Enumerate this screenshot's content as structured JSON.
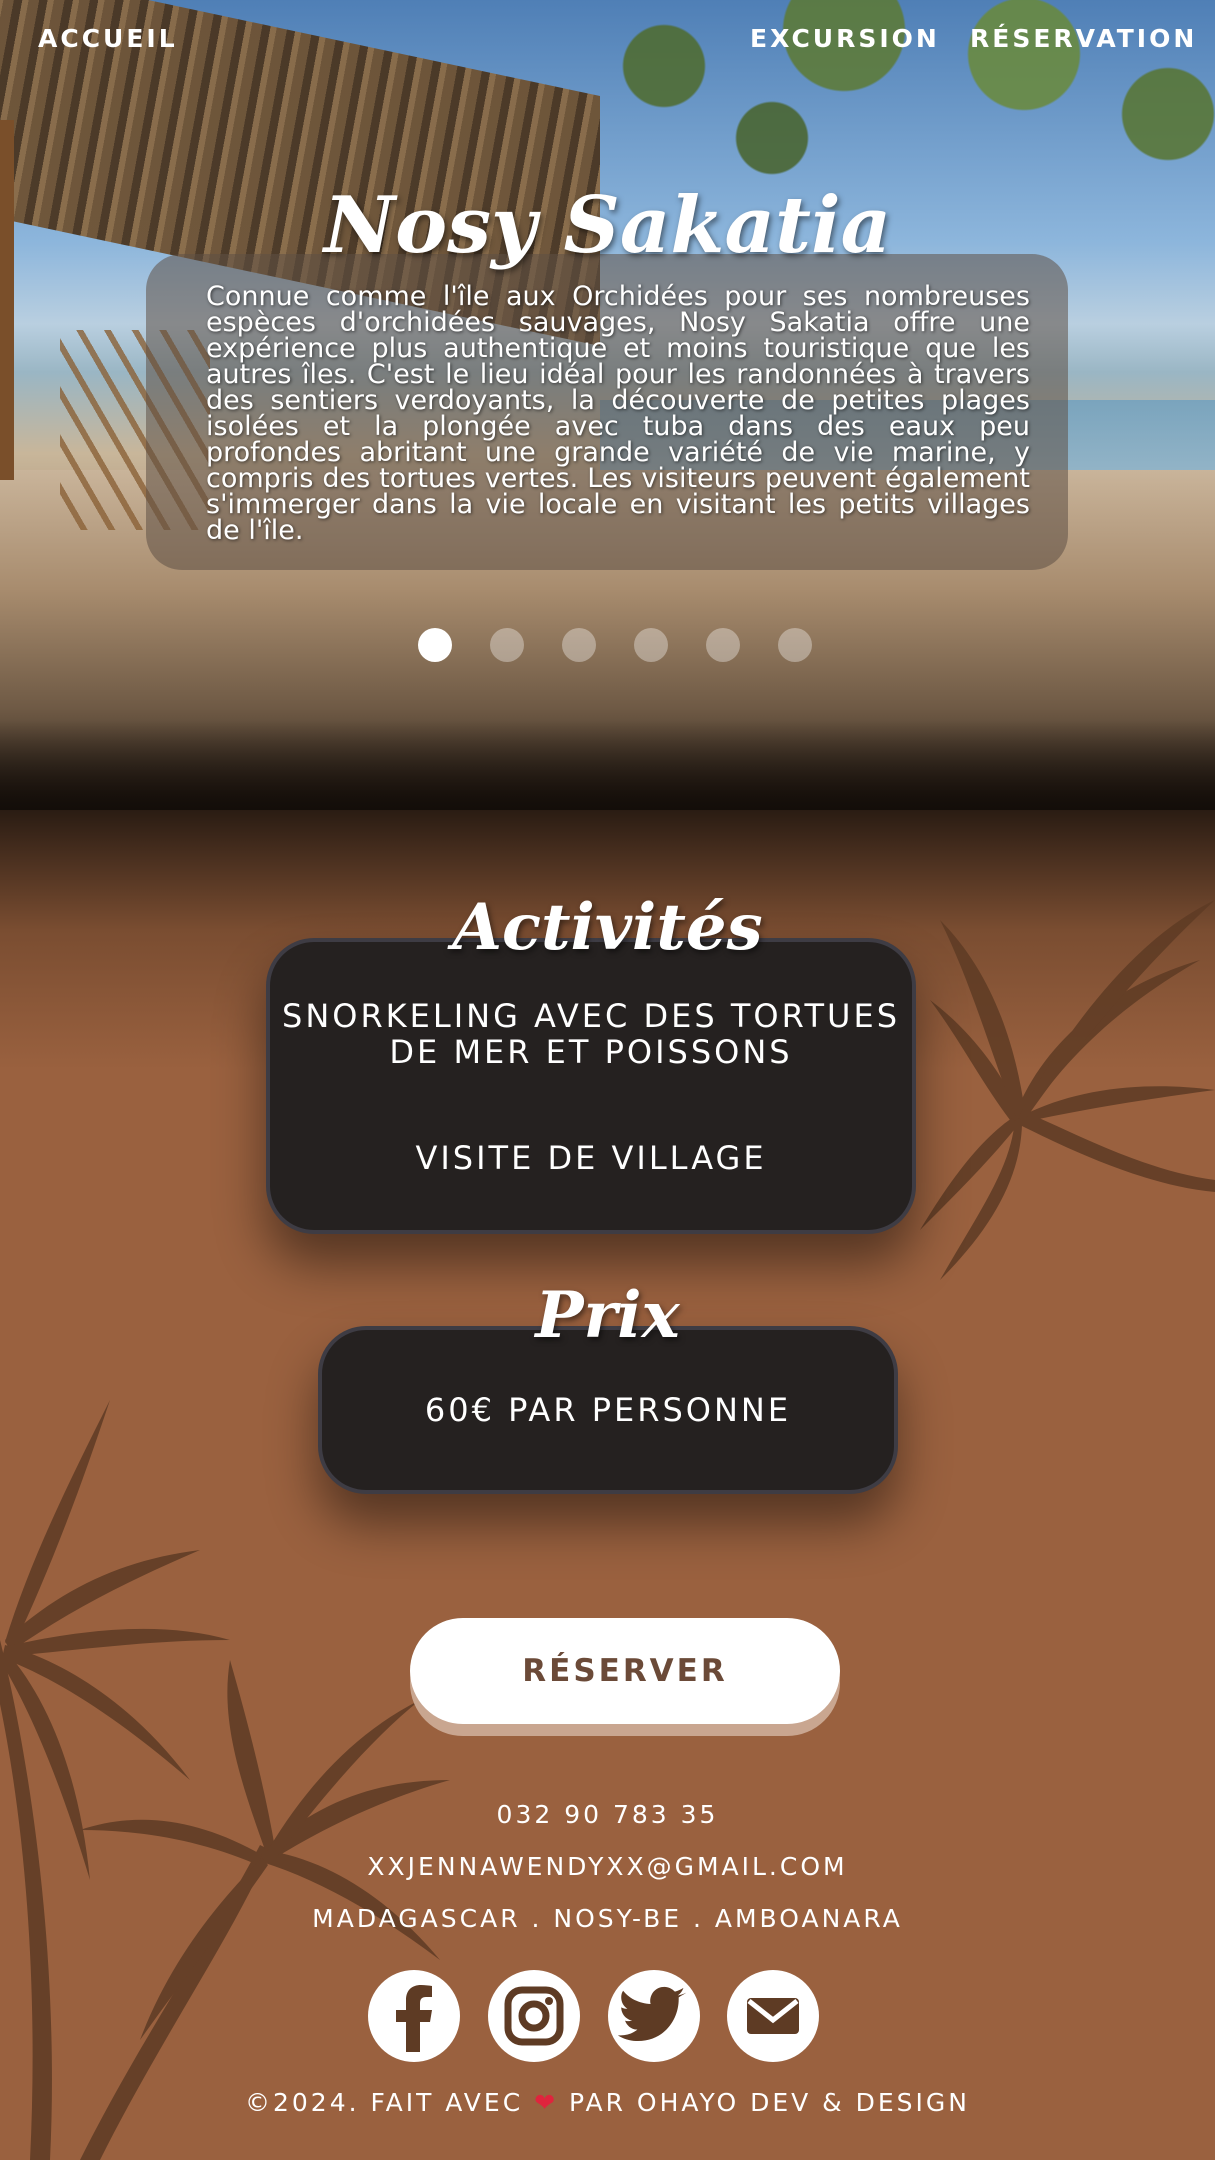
{
  "nav": {
    "home": "ACCUEIL",
    "excursion": "EXCURSION",
    "reservation": "RÉSERVATION"
  },
  "hero": {
    "title": "Nosy Sakatia",
    "description": "Connue comme l'île aux Orchidées pour ses nombreuses espèces d'orchidées sauvages, Nosy Sakatia offre une expérience plus authentique et moins touristique que les autres îles. C'est le lieu idéal pour les randonnées à travers des sentiers verdoyants, la découverte de petites plages isolées et la plongée avec tuba dans des eaux peu profondes abritant une grande variété de vie marine, y compris des tortues vertes. Les visiteurs peuvent également s'immerger dans la vie locale en visitant les petits villages de l'île.",
    "carousel": {
      "slides": 6,
      "active": 1
    }
  },
  "activities": {
    "title": "Activités",
    "items": [
      "SNORKELING AVEC DES TORTUES DE MER ET POISSONS",
      "VISITE DE VILLAGE"
    ]
  },
  "price": {
    "title": "Prix",
    "value": "60€ PAR PERSONNE"
  },
  "reserve_button": "RÉSERVER",
  "contact": {
    "phone": "032 90 783 35",
    "email": "XXJENNAWENDYXX@GMAIL.COM",
    "address": "MADAGASCAR . NOSY-BE . AMBOANARA"
  },
  "social": [
    "facebook-icon",
    "instagram-icon",
    "twitter-icon",
    "mail-icon"
  ],
  "footer": {
    "before": "©2024. FAIT AVEC",
    "after": "PAR OHAYO DEV & DESIGN"
  },
  "colors": {
    "background": "#9a613f",
    "card": "#252120",
    "button_text": "#6b4a38",
    "heart": "#e0243d"
  }
}
